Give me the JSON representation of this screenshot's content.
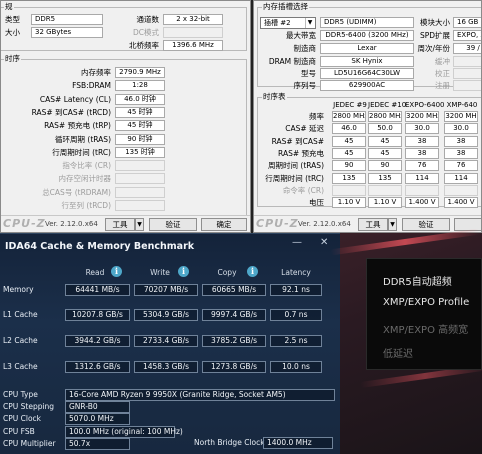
{
  "cpuz_left": {
    "module_group_title": "规",
    "type_label": "类型",
    "type_value": "DDR5",
    "size_label": "大小",
    "size_value": "32 GBytes",
    "channels_label": "通道数",
    "channels_value": "2 x 32-bit",
    "dc_mode_label": "DC模式",
    "nb_freq_label": "北桥频率",
    "nb_freq_value": "1396.6 MHz",
    "timing_group_title": "时序",
    "timings": [
      {
        "label": "内存频率",
        "value": "2790.9 MHz",
        "dim": false
      },
      {
        "label": "FSB:DRAM",
        "value": "1:28",
        "dim": false
      },
      {
        "label": "CAS# Latency (CL)",
        "value": "46.0 时钟",
        "dim": false
      },
      {
        "label": "RAS# 到CAS# (tRCD)",
        "value": "45 时钟",
        "dim": false
      },
      {
        "label": "RAS# 预充电 (tRP)",
        "value": "45 时钟",
        "dim": false
      },
      {
        "label": "循环周期 (tRAS)",
        "value": "90 时钟",
        "dim": false
      },
      {
        "label": "行周期时间 (tRC)",
        "value": "135 时钟",
        "dim": false
      },
      {
        "label": "指令比率 (CR)",
        "value": "",
        "dim": true
      },
      {
        "label": "内存空闲计时器",
        "value": "",
        "dim": true
      },
      {
        "label": "总CAS号 (tRDRAM)",
        "value": "",
        "dim": true
      },
      {
        "label": "行至列 (tRCD)",
        "value": "",
        "dim": true
      }
    ],
    "logo": "CPU-Z",
    "version": "Ver. 2.12.0.x64",
    "tools_label": "工具",
    "validate_label": "验证",
    "ok_label": "确定"
  },
  "cpuz_right": {
    "slot_group_title": "内存插槽选择",
    "slot_value": "插槽 #2",
    "slot_type": "DDR5 (UDIMM)",
    "module_size_label": "模块大小",
    "module_size_value": "16 GB",
    "max_bw_label": "最大带宽",
    "max_bw_value": "DDR5-6400 (3200 MHz)",
    "spd_ext_label": "SPD扩展",
    "spd_ext_value": "EXPO, XM",
    "manufacturer_label": "制造商",
    "manufacturer_value": "Lexar",
    "week_year_label": "周次/年份",
    "week_year_value": "39 /",
    "dram_mfr_label": "DRAM 制造商",
    "dram_mfr_value": "SK Hynix",
    "buffered_label": "缓冲",
    "model_label": "型号",
    "model_value": "LD5U16G64C30LW",
    "corrected_label": "校正",
    "serial_label": "序列号",
    "serial_value": "629900AC",
    "registered_label": "注册",
    "timing_table_title": "时序表",
    "columns": [
      "JEDEC #9",
      "JEDEC #10",
      "EXPO-6400",
      "XMP-640"
    ],
    "rows": [
      {
        "label": "频率",
        "values": [
          "2800 MHz",
          "2800 MHz",
          "3200 MHz",
          "3200 MH"
        ],
        "dim": false
      },
      {
        "label": "CAS# 延迟",
        "values": [
          "46.0",
          "50.0",
          "30.0",
          "30.0"
        ],
        "dim": false
      },
      {
        "label": "RAS# 到CAS#",
        "values": [
          "45",
          "45",
          "38",
          "38"
        ],
        "dim": false
      },
      {
        "label": "RAS# 预充电",
        "values": [
          "45",
          "45",
          "38",
          "38"
        ],
        "dim": false
      },
      {
        "label": "周期时间 (tRAS)",
        "values": [
          "90",
          "90",
          "76",
          "76"
        ],
        "dim": false
      },
      {
        "label": "行周期时间 (tRC)",
        "values": [
          "135",
          "135",
          "114",
          "114"
        ],
        "dim": false
      },
      {
        "label": "命令率 (CR)",
        "values": [
          "",
          "",
          "",
          ""
        ],
        "dim": true
      },
      {
        "label": "电压",
        "values": [
          "1.10 V",
          "1.10 V",
          "1.400 V",
          "1.400 V"
        ],
        "dim": false
      }
    ],
    "logo": "CPU-Z",
    "version": "Ver. 2.12.0.x64",
    "tools_label": "工具",
    "validate_label": "验证"
  },
  "aida": {
    "title": "IDA64 Cache & Memory Benchmark",
    "minimize": "—",
    "close": "✕",
    "headers": {
      "read": "Read",
      "write": "Write",
      "copy": "Copy",
      "latency": "Latency"
    },
    "bench_rows": [
      {
        "label": "Memory",
        "read": "64441 MB/s",
        "write": "70207 MB/s",
        "copy": "60665 MB/s",
        "latency": "92.1 ns"
      },
      {
        "label": "L1 Cache",
        "read": "10207.8 GB/s",
        "write": "5304.9 GB/s",
        "copy": "9997.4 GB/s",
        "latency": "0.7 ns"
      },
      {
        "label": "L2 Cache",
        "read": "3944.2 GB/s",
        "write": "2733.4 GB/s",
        "copy": "3785.2 GB/s",
        "latency": "2.5 ns"
      },
      {
        "label": "L3 Cache",
        "read": "1312.6 GB/s",
        "write": "1458.3 GB/s",
        "copy": "1273.8 GB/s",
        "latency": "10.0 ns"
      }
    ],
    "info_rows": [
      {
        "label": "CPU Type",
        "value": "16-Core AMD Ryzen 9 9950X  (Granite Ridge, Socket AM5)"
      },
      {
        "label": "CPU Stepping",
        "value": "GNR-B0"
      },
      {
        "label": "CPU Clock",
        "value": "5070.0 MHz"
      },
      {
        "label": "CPU FSB",
        "value": "100.0 MHz  (original: 100 MHz)"
      },
      {
        "label": "CPU Multiplier",
        "value": "50.7x"
      }
    ],
    "nb_clock_label": "North Bridge Clock",
    "nb_clock_value": "1400.0 MHz"
  },
  "menu": {
    "items": [
      {
        "label": "DDR5自动超频",
        "state": "normal"
      },
      {
        "label": "XMP/EXPO Profile",
        "state": "normal"
      },
      {
        "label": "XMP/EXPO 高频宽",
        "state": "disabled"
      },
      {
        "label": "低延迟",
        "state": "disabled"
      }
    ],
    "colors": {
      "normal": "#e8e8e8",
      "disabled": "#6a6a6a"
    }
  }
}
